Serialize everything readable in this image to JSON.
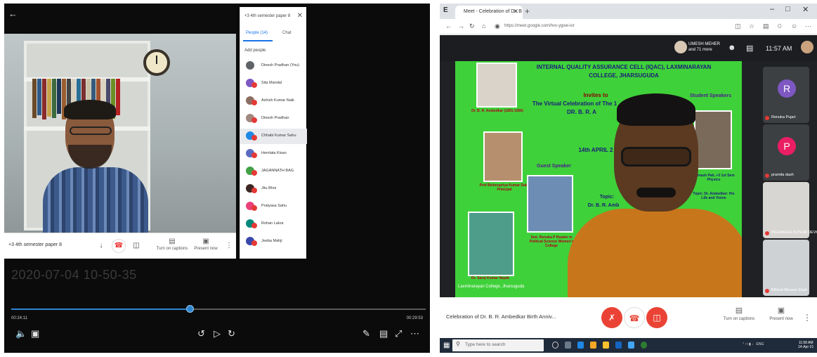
{
  "left_player": {
    "back_icon": "back-arrow-icon",
    "recording_timestamp": "2020-07-04 10-50-35",
    "time_current": "00:24:11",
    "time_total": "00:29:53",
    "progress": 0.43,
    "meeting_name": "+3 4th semester paper 8",
    "caption_label": "Turn on captions",
    "present_label": "Present now",
    "people_panel": {
      "title": "+3 4th semester paper 8",
      "tab_people": "People (14)",
      "tab_chat": "Chat",
      "add_people": "Add people",
      "participants": [
        {
          "name": "Dinesh Pradhan (You)",
          "color": "#5f6368"
        },
        {
          "name": "Sita Mandal",
          "color": "#7e57c2"
        },
        {
          "name": "Ashish Kumar Naik",
          "color": "#8d6e63"
        },
        {
          "name": "Dinesh Pradhan",
          "color": "#a1887f"
        },
        {
          "name": "Chhabi Kumar Sahu",
          "color": "#1e88e5"
        },
        {
          "name": "Hemlata Kisan",
          "color": "#5c6bc0"
        },
        {
          "name": "JAGANNATH BAG",
          "color": "#43a047"
        },
        {
          "name": "Jitu Bhoi",
          "color": "#3e2723"
        },
        {
          "name": "Pratyasa Sahu",
          "color": "#ec407a"
        },
        {
          "name": "Rohan Lakra",
          "color": "#00897b"
        },
        {
          "name": "Jeeba Mahji",
          "color": "#3949ab"
        }
      ]
    }
  },
  "right_browser": {
    "tab_title": "Meet - Celebration of Dr. B",
    "url": "https://meet.google.com/hvx-ygwe-ior",
    "host_name": "UMESH MEHER",
    "host_more": "and 71 more",
    "clock": "11:57 AM",
    "poster": {
      "org_line1": "INTERNAL QUALITY ASSURANCE CELL (IQAC), LAXMINARAYAN",
      "org_line2": "COLLEGE, JHARSUGUDA",
      "invites": "Invites to",
      "event_line1": "The Virtual Celebration of The 1",
      "event_line2": "DR. B. R. A",
      "date": "14th APRIL 2",
      "student_speakers": "Student Speakers",
      "guest_speaker": "Guest Speaker",
      "topic": "Topic:",
      "topic_name": "Dr. B. R. Amb",
      "caption_ambedkar": "Dr. B. R. Ambedkar (1891-1956)",
      "caption_principal": "Prof Bishnupriya Kumar Dalai Principal",
      "caption_reader": "Smt. Renuka P Reader in Political Science Women's College",
      "caption_convenor": "Dr. Saroj Kumar Nayak",
      "student_name": "Abinash Pati, +3 1st Sem Physics",
      "student_topic": "Topic: Dr. Ambedkar: His Life and Vision",
      "venue": "Laxminarayan College, Jharsuguda"
    },
    "tiles": [
      {
        "initial": "R",
        "name": "Renuka Pujari",
        "color": "#7e57c2"
      },
      {
        "initial": "P",
        "name": "pramita dash",
        "color": "#e91e63"
      },
      {
        "initial": "",
        "name": "BIGANGGA KUSUM DEVKAN",
        "color": ""
      },
      {
        "initial": "",
        "name": "Bibhuti Bhusan Dash",
        "color": ""
      }
    ],
    "meeting_title": "Celebration of Dr. B. R. Ambedkar Birth Anniv...",
    "caption_label": "Turn on captions",
    "present_label": "Present now",
    "taskbar": {
      "search_placeholder": "Type here to search",
      "tray_time": "11:58 AM",
      "tray_date": "14-Apr-21"
    }
  }
}
